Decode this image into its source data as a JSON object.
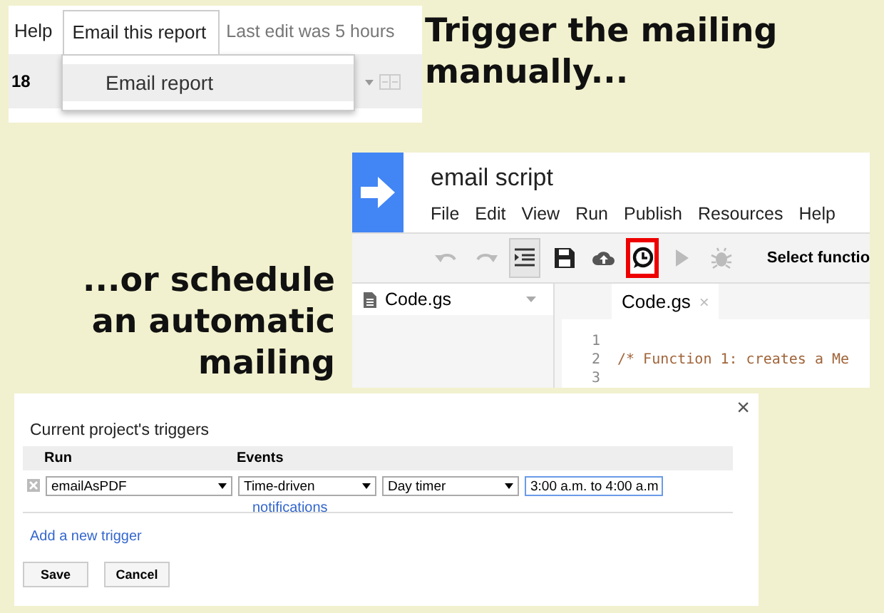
{
  "report_menu": {
    "menu_items": [
      {
        "label": "Help",
        "selected": false
      },
      {
        "label": "Email this report",
        "selected": true
      }
    ],
    "last_edit": "Last edit was 5 hours",
    "toolbar_value": "18",
    "dropdown_items": [
      {
        "label": "Email report",
        "highlighted": true
      }
    ]
  },
  "captions": [
    {
      "text": "Trigger the mailing manually..."
    },
    {
      "text": "...or schedule an automatic mailing"
    }
  ],
  "script_editor": {
    "title": "email script",
    "menu": [
      "File",
      "Edit",
      "View",
      "Run",
      "Publish",
      "Resources",
      "Help"
    ],
    "toolbar": [
      {
        "kind": "undo",
        "highlighted": false,
        "pressed": false
      },
      {
        "kind": "redo",
        "highlighted": false,
        "pressed": false
      },
      {
        "kind": "indent",
        "highlighted": false,
        "pressed": true
      },
      {
        "kind": "save",
        "highlighted": false,
        "pressed": false
      },
      {
        "kind": "deploy",
        "highlighted": false,
        "pressed": false
      },
      {
        "kind": "triggers",
        "highlighted": true,
        "pressed": false
      },
      {
        "kind": "run",
        "highlighted": false,
        "pressed": false
      },
      {
        "kind": "debug",
        "highlighted": false,
        "pressed": false
      }
    ],
    "function_select": "Select functio",
    "files": [
      {
        "name": "Code.gs"
      }
    ],
    "tabs": [
      {
        "label": "Code.gs",
        "close": "×"
      }
    ],
    "lines": [
      {
        "number": "1"
      },
      {
        "number": "2",
        "code": "/* Function 1: creates a Me"
      },
      {
        "number": "3"
      }
    ]
  },
  "triggers_dialog": {
    "close": "×",
    "title": "Current project's triggers",
    "columns": [
      "Run",
      "Events"
    ],
    "triggers": [
      {
        "function": "emailAsPDF",
        "events": [
          {
            "value": "Time-driven",
            "focused": false
          },
          {
            "value": "Day timer",
            "focused": false
          },
          {
            "value": "3:00 a.m. to 4:00 a.m",
            "focused": true
          }
        ],
        "link": "notifications"
      }
    ],
    "add_link": "Add a new trigger",
    "buttons": [
      "Save",
      "Cancel"
    ]
  }
}
